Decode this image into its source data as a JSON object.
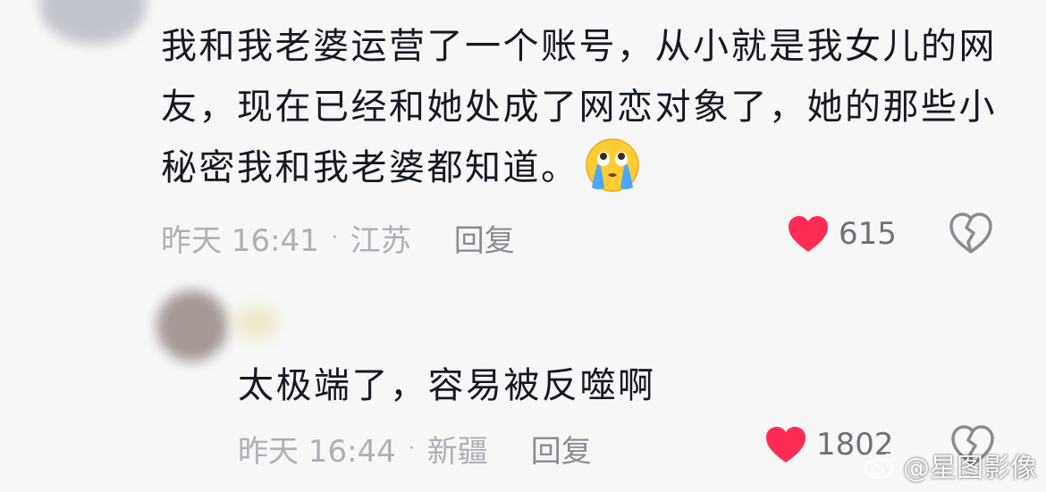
{
  "comments": [
    {
      "text": "我和我老婆运营了一个账号，从小就是我女儿的网友，现在已经和她处成了网恋对象了，她的那些小秘密我和我老婆都知道。",
      "emoji_icon": "crying-face-emoji",
      "time": "昨天 16:41",
      "separator": "·",
      "location": "江苏",
      "reply_label": "回复",
      "likes": "615",
      "like_icon": "heart-icon",
      "dislike_icon": "broken-heart-icon"
    },
    {
      "text": "太极端了，容易被反噬啊",
      "time": "昨天 16:44",
      "separator": "·",
      "location": "新疆",
      "reply_label": "回复",
      "likes": "1802",
      "like_icon": "heart-icon",
      "dislike_icon": "broken-heart-icon"
    }
  ],
  "watermark": {
    "icon": "weibo-logo-icon",
    "text": "@星图影像"
  },
  "colors": {
    "background": "#f7f7f7",
    "text": "#161823",
    "meta": "#aeb0b6",
    "like_red": "#fe2c55"
  }
}
